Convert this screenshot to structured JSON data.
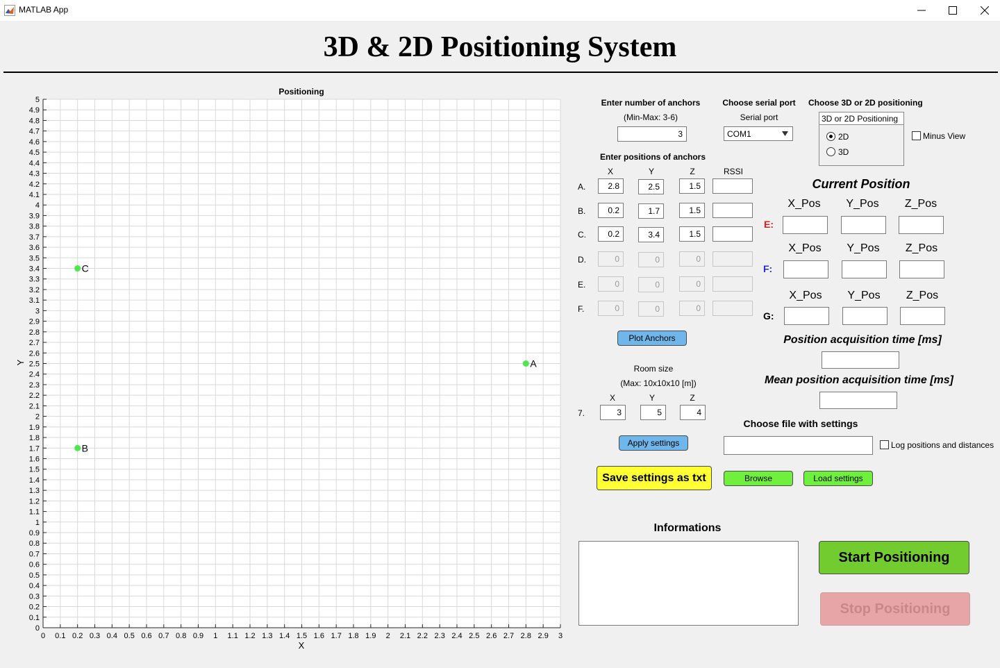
{
  "window": {
    "title": "MATLAB App",
    "minimize_glyph": "—",
    "maximize_glyph": "☐",
    "close_glyph": "✕"
  },
  "header": {
    "title": "3D & 2D Positioning System"
  },
  "plot": {
    "title": "Positioning",
    "xlabel": "X",
    "ylabel": "Y",
    "anchors": [
      {
        "label": "A",
        "x": 2.8,
        "y": 2.5
      },
      {
        "label": "B",
        "x": 0.2,
        "y": 1.7
      },
      {
        "label": "C",
        "x": 0.2,
        "y": 3.4
      }
    ]
  },
  "chart_data": {
    "type": "scatter",
    "title": "Positioning",
    "xlabel": "X",
    "ylabel": "Y",
    "xlim": [
      0,
      3
    ],
    "ylim": [
      0,
      5
    ],
    "x_tick_step": 0.1,
    "y_tick_step": 0.1,
    "grid": true,
    "marker_color": "#4ce84c",
    "points": [
      {
        "label": "A",
        "x": 2.8,
        "y": 2.5
      },
      {
        "label": "B",
        "x": 0.2,
        "y": 1.7
      },
      {
        "label": "C",
        "x": 0.2,
        "y": 3.4
      }
    ]
  },
  "anchors_count": {
    "label": "Enter number of anchors",
    "hint": "(Min-Max: 3-6)",
    "value": "3"
  },
  "serial": {
    "label": "Choose serial port",
    "sublabel": "Serial port",
    "value": "COM1"
  },
  "mode": {
    "label": "Choose 3D or 2D positioning",
    "group_title": "3D or 2D Positioning",
    "options": [
      "2D",
      "3D"
    ],
    "selected": "2D",
    "minus_view": "Minus View"
  },
  "anchor_table": {
    "label": "Enter positions of anchors",
    "headers": {
      "x": "X",
      "y": "Y",
      "z": "Z",
      "rssi": "RSSI"
    },
    "rows": [
      {
        "label": "A.",
        "x": "2.8",
        "y": "2.5",
        "z": "1.5",
        "rssi": "",
        "enabled": true
      },
      {
        "label": "B.",
        "x": "0.2",
        "y": "1.7",
        "z": "1.5",
        "rssi": "",
        "enabled": true
      },
      {
        "label": "C.",
        "x": "0.2",
        "y": "3.4",
        "z": "1.5",
        "rssi": "",
        "enabled": true
      },
      {
        "label": "D.",
        "x": "0",
        "y": "0",
        "z": "0",
        "rssi": "",
        "enabled": false
      },
      {
        "label": "E.",
        "x": "0",
        "y": "0",
        "z": "0",
        "rssi": "",
        "enabled": false
      },
      {
        "label": "F.",
        "x": "0",
        "y": "0",
        "z": "0",
        "rssi": "",
        "enabled": false
      }
    ],
    "plot_button": "Plot Anchors"
  },
  "room": {
    "label": "Room size",
    "hint": "(Max: 10x10x10 [m])",
    "headers": {
      "x": "X",
      "y": "Y",
      "z": "Z"
    },
    "row_label": "7.",
    "x": "3",
    "y": "5",
    "z": "4",
    "apply_button": "Apply settings"
  },
  "current_position": {
    "title": "Current Position",
    "headers": {
      "x": "X_Pos",
      "y": "Y_Pos",
      "z": "Z_Pos"
    },
    "tags": [
      {
        "label": "E:",
        "color": "#d42020"
      },
      {
        "label": "F:",
        "color": "#2a2ae0"
      },
      {
        "label": "G:",
        "color": "#000000"
      }
    ]
  },
  "acquisition": {
    "label": "Position acquisition time [ms]",
    "mean_label": "Mean position acquisition time [ms]",
    "value": "",
    "mean_value": ""
  },
  "file": {
    "label": "Choose file with settings",
    "path": "",
    "log_checkbox": "Log positions and distances",
    "save_button": "Save settings as txt",
    "browse_button": "Browse",
    "load_button": "Load settings"
  },
  "info": {
    "label": "Informations",
    "text": ""
  },
  "actions": {
    "start": "Start Positioning",
    "stop": "Stop Positioning"
  },
  "colors": {
    "plot_button": "#6fb6ea",
    "save_button": "#ffff33",
    "green_button": "#6ef03c",
    "start_button": "#72cc30",
    "stop_button": "#e8a5a8",
    "stop_text": "#c8888b"
  }
}
